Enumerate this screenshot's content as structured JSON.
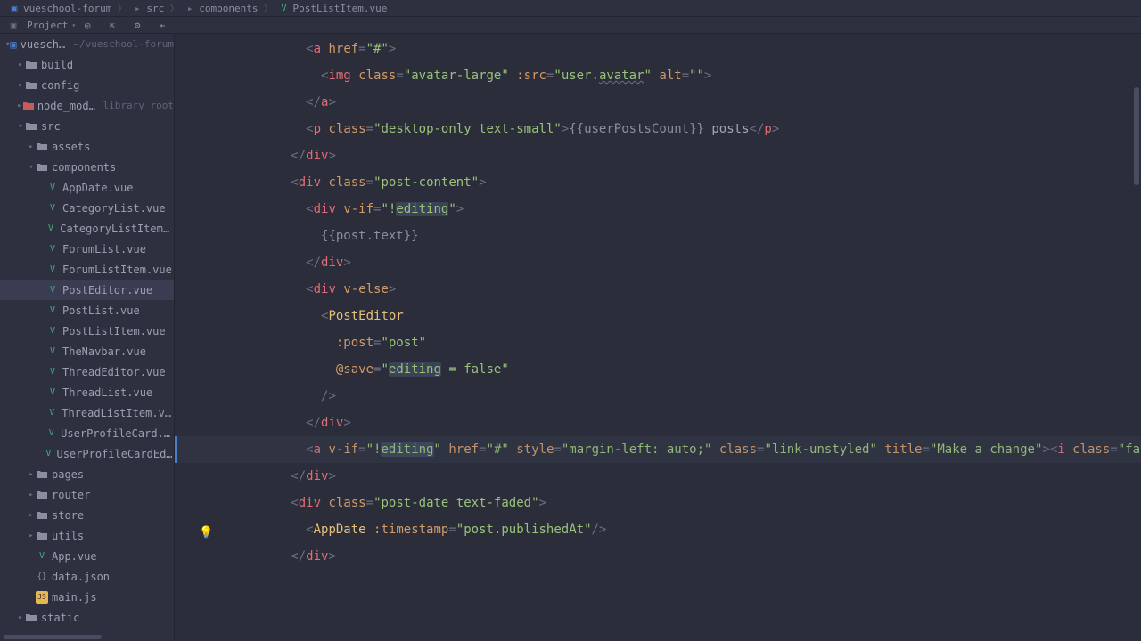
{
  "breadcrumbs": [
    {
      "icon": "project",
      "label": "vueschool-forum"
    },
    {
      "icon": "dir",
      "label": "src"
    },
    {
      "icon": "dir",
      "label": "components"
    },
    {
      "icon": "vue",
      "label": "PostListItem.vue"
    }
  ],
  "toolbar": {
    "view_label": "Project",
    "icons": [
      "target-icon",
      "collapse-icon",
      "settings-icon",
      "hide-icon"
    ]
  },
  "tree": [
    {
      "d": 0,
      "chev": "down",
      "icon": "project",
      "label": "vueschool-forum",
      "hint": "~/vueschool-forum"
    },
    {
      "d": 1,
      "chev": "right",
      "icon": "dir",
      "label": "build"
    },
    {
      "d": 1,
      "chev": "right",
      "icon": "dir",
      "label": "config"
    },
    {
      "d": 1,
      "chev": "right",
      "icon": "dir-x",
      "label": "node_modules",
      "hint": "library root"
    },
    {
      "d": 1,
      "chev": "down",
      "icon": "dir",
      "label": "src"
    },
    {
      "d": 2,
      "chev": "right",
      "icon": "dir",
      "label": "assets"
    },
    {
      "d": 2,
      "chev": "down",
      "icon": "dir",
      "label": "components"
    },
    {
      "d": 3,
      "icon": "vue",
      "label": "AppDate.vue"
    },
    {
      "d": 3,
      "icon": "vue",
      "label": "CategoryList.vue"
    },
    {
      "d": 3,
      "icon": "vue",
      "label": "CategoryListItem.vue"
    },
    {
      "d": 3,
      "icon": "vue",
      "label": "ForumList.vue"
    },
    {
      "d": 3,
      "icon": "vue",
      "label": "ForumListItem.vue"
    },
    {
      "d": 3,
      "icon": "vue",
      "label": "PostEditor.vue",
      "selected": true
    },
    {
      "d": 3,
      "icon": "vue",
      "label": "PostList.vue"
    },
    {
      "d": 3,
      "icon": "vue",
      "label": "PostListItem.vue"
    },
    {
      "d": 3,
      "icon": "vue",
      "label": "TheNavbar.vue"
    },
    {
      "d": 3,
      "icon": "vue",
      "label": "ThreadEditor.vue"
    },
    {
      "d": 3,
      "icon": "vue",
      "label": "ThreadList.vue"
    },
    {
      "d": 3,
      "icon": "vue",
      "label": "ThreadListItem.vue"
    },
    {
      "d": 3,
      "icon": "vue",
      "label": "UserProfileCard.vue"
    },
    {
      "d": 3,
      "icon": "vue",
      "label": "UserProfileCardEditor.vue"
    },
    {
      "d": 2,
      "chev": "right",
      "icon": "dir",
      "label": "pages"
    },
    {
      "d": 2,
      "chev": "right",
      "icon": "dir",
      "label": "router"
    },
    {
      "d": 2,
      "chev": "right",
      "icon": "dir",
      "label": "store"
    },
    {
      "d": 2,
      "chev": "right",
      "icon": "dir",
      "label": "utils"
    },
    {
      "d": 2,
      "icon": "vue",
      "label": "App.vue"
    },
    {
      "d": 2,
      "icon": "json",
      "label": "data.json"
    },
    {
      "d": 2,
      "icon": "js",
      "label": "main.js"
    },
    {
      "d": 1,
      "chev": "right",
      "icon": "dir",
      "label": "static"
    }
  ],
  "code_lines": [
    {
      "indent": 12,
      "tokens": [
        [
          "punct",
          "<"
        ],
        [
          "tag",
          "a"
        ],
        [
          "default",
          " "
        ],
        [
          "attr",
          "href"
        ],
        [
          "punct",
          "="
        ],
        [
          "str",
          "\"#\""
        ],
        [
          "punct",
          ">"
        ]
      ]
    },
    {
      "indent": 14,
      "tokens": [
        [
          "punct",
          "<"
        ],
        [
          "tag",
          "img"
        ],
        [
          "default",
          " "
        ],
        [
          "attr",
          "class"
        ],
        [
          "punct",
          "="
        ],
        [
          "str",
          "\"avatar-large\""
        ],
        [
          "default",
          " "
        ],
        [
          "attr",
          ":src"
        ],
        [
          "punct",
          "="
        ],
        [
          "str",
          "\"user."
        ],
        [
          "str-under",
          "avatar"
        ],
        [
          "str",
          "\""
        ],
        [
          "default",
          " "
        ],
        [
          "attr",
          "alt"
        ],
        [
          "punct",
          "="
        ],
        [
          "str",
          "\"\""
        ],
        [
          "punct",
          ">"
        ]
      ]
    },
    {
      "indent": 12,
      "tokens": [
        [
          "punct",
          "</"
        ],
        [
          "tag",
          "a"
        ],
        [
          "punct",
          ">"
        ]
      ]
    },
    {
      "indent": 0,
      "tokens": []
    },
    {
      "indent": 0,
      "tokens": []
    },
    {
      "indent": 12,
      "tokens": [
        [
          "punct",
          "<"
        ],
        [
          "tag",
          "p"
        ],
        [
          "default",
          " "
        ],
        [
          "attr",
          "class"
        ],
        [
          "punct",
          "="
        ],
        [
          "str",
          "\"desktop-only text-small\""
        ],
        [
          "punct",
          ">"
        ],
        [
          "mustache",
          "{{userPostsCount}}"
        ],
        [
          "default",
          " posts"
        ],
        [
          "punct",
          "</"
        ],
        [
          "tag",
          "p"
        ],
        [
          "punct",
          ">"
        ]
      ]
    },
    {
      "indent": 10,
      "tokens": [
        [
          "punct",
          "</"
        ],
        [
          "tag",
          "div"
        ],
        [
          "punct",
          ">"
        ]
      ]
    },
    {
      "indent": 0,
      "tokens": []
    },
    {
      "indent": 10,
      "tokens": [
        [
          "punct",
          "<"
        ],
        [
          "tag",
          "div"
        ],
        [
          "default",
          " "
        ],
        [
          "attr",
          "class"
        ],
        [
          "punct",
          "="
        ],
        [
          "str",
          "\"post-content\""
        ],
        [
          "punct",
          ">"
        ]
      ]
    },
    {
      "indent": 12,
      "tokens": [
        [
          "punct",
          "<"
        ],
        [
          "tag",
          "div"
        ],
        [
          "default",
          " "
        ],
        [
          "attr",
          "v-if"
        ],
        [
          "punct",
          "="
        ],
        [
          "str",
          "\"!"
        ],
        [
          "str-hl",
          "editing"
        ],
        [
          "str",
          "\""
        ],
        [
          "punct",
          ">"
        ]
      ]
    },
    {
      "indent": 14,
      "tokens": [
        [
          "mustache",
          "{{post.text}}"
        ]
      ]
    },
    {
      "indent": 12,
      "tokens": [
        [
          "punct",
          "</"
        ],
        [
          "tag",
          "div"
        ],
        [
          "punct",
          ">"
        ]
      ]
    },
    {
      "indent": 12,
      "tokens": [
        [
          "punct",
          "<"
        ],
        [
          "tag",
          "div"
        ],
        [
          "default",
          " "
        ],
        [
          "attr",
          "v-else"
        ],
        [
          "punct",
          ">"
        ]
      ]
    },
    {
      "indent": 14,
      "tokens": [
        [
          "punct",
          "<"
        ],
        [
          "comp",
          "PostEditor"
        ]
      ]
    },
    {
      "indent": 16,
      "tokens": [
        [
          "attr",
          ":post"
        ],
        [
          "punct",
          "="
        ],
        [
          "str",
          "\"post\""
        ]
      ]
    },
    {
      "indent": 16,
      "tokens": [
        [
          "attr",
          "@save"
        ],
        [
          "punct",
          "="
        ],
        [
          "str",
          "\""
        ],
        [
          "str-hl",
          "editing"
        ],
        [
          "str",
          " = false\""
        ]
      ]
    },
    {
      "indent": 14,
      "tokens": [
        [
          "punct",
          "/>"
        ]
      ]
    },
    {
      "indent": 12,
      "tokens": [
        [
          "punct",
          "</"
        ],
        [
          "tag",
          "div"
        ],
        [
          "punct",
          ">"
        ]
      ]
    },
    {
      "indent": 12,
      "current": true,
      "mark": true,
      "bulb": true,
      "tokens": [
        [
          "punct",
          "<"
        ],
        [
          "tag",
          "a"
        ],
        [
          "default",
          " "
        ],
        [
          "attr",
          "v-if"
        ],
        [
          "punct",
          "="
        ],
        [
          "str",
          "\"!"
        ],
        [
          "str-hl",
          "editing"
        ],
        [
          "caret",
          ""
        ],
        [
          "str",
          "\""
        ],
        [
          "default",
          " "
        ],
        [
          "attr",
          "href"
        ],
        [
          "punct",
          "="
        ],
        [
          "str",
          "\"#\""
        ],
        [
          "default",
          " "
        ],
        [
          "attr",
          "style"
        ],
        [
          "punct",
          "="
        ],
        [
          "str",
          "\"margin-left: auto;\""
        ],
        [
          "default",
          " "
        ],
        [
          "attr",
          "class"
        ],
        [
          "punct",
          "="
        ],
        [
          "str",
          "\"link-unstyled\""
        ],
        [
          "default",
          " "
        ],
        [
          "attr",
          "title"
        ],
        [
          "punct",
          "="
        ],
        [
          "str",
          "\"Make a change\""
        ],
        [
          "punct",
          ">"
        ],
        [
          "punct",
          "<"
        ],
        [
          "tag",
          "i"
        ],
        [
          "default",
          " "
        ],
        [
          "attr",
          "class"
        ],
        [
          "punct",
          "="
        ],
        [
          "str",
          "\"fa fa-pencil\""
        ],
        [
          "punct",
          ">"
        ]
      ]
    },
    {
      "indent": 10,
      "cursor_after": true,
      "tokens": [
        [
          "punct",
          "</"
        ],
        [
          "tag",
          "div"
        ],
        [
          "punct",
          ">"
        ]
      ]
    },
    {
      "indent": 0,
      "tokens": []
    },
    {
      "indent": 10,
      "tokens": [
        [
          "punct",
          "<"
        ],
        [
          "tag",
          "div"
        ],
        [
          "default",
          " "
        ],
        [
          "attr",
          "class"
        ],
        [
          "punct",
          "="
        ],
        [
          "str",
          "\"post-date text-faded\""
        ],
        [
          "punct",
          ">"
        ]
      ]
    },
    {
      "indent": 12,
      "tokens": [
        [
          "punct",
          "<"
        ],
        [
          "comp",
          "AppDate"
        ],
        [
          "default",
          " "
        ],
        [
          "attr",
          ":timestamp"
        ],
        [
          "punct",
          "="
        ],
        [
          "str",
          "\"post.publishedAt\""
        ],
        [
          "punct",
          "/>"
        ]
      ]
    },
    {
      "indent": 10,
      "tokens": [
        [
          "punct",
          "</"
        ],
        [
          "tag",
          "div"
        ],
        [
          "punct",
          ">"
        ]
      ]
    }
  ]
}
